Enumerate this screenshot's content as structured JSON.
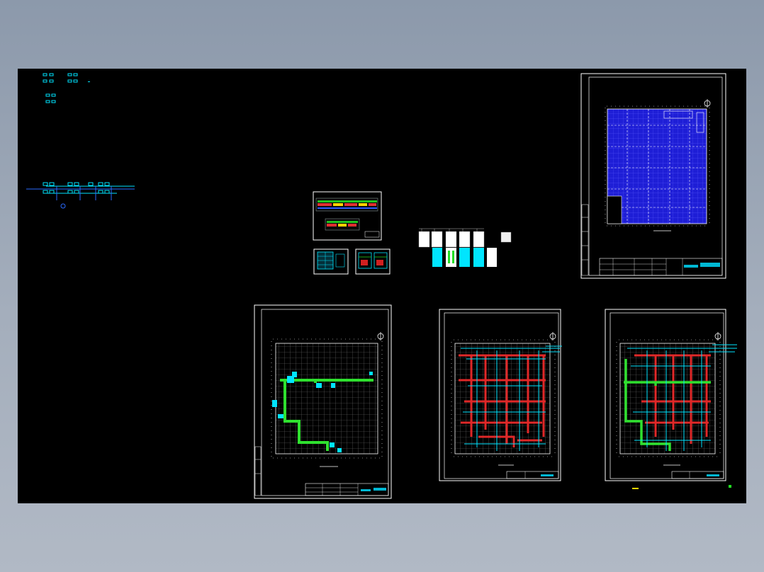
{
  "app": {
    "view": "model-space",
    "colors": {
      "background": "#000000",
      "frame": "#ffffff",
      "cyan": "#00e5ff",
      "green": "#22dd22",
      "red": "#e02020",
      "blue_fill": "#1a1ad0",
      "yellow": "#ffd800",
      "grid": "#7a7a7a"
    }
  },
  "drawing_sheets": [
    {
      "id": "sheet-top-right",
      "style": "blue-hatched-floor-plan",
      "has_north_arrow": true
    },
    {
      "id": "sheet-bottom-left",
      "style": "green-duct-plan",
      "has_north_arrow": true
    },
    {
      "id": "sheet-bottom-middle",
      "style": "red-cyan-piping-plan",
      "has_north_arrow": true
    },
    {
      "id": "sheet-bottom-right",
      "style": "green-red-combined-plan",
      "has_north_arrow": true
    }
  ],
  "small_details": [
    {
      "id": "elevation-sheet",
      "style": "colored-elevation"
    },
    {
      "id": "detail-sheet-a",
      "style": "cyan-detail"
    },
    {
      "id": "detail-sheet-b",
      "style": "section-detail"
    },
    {
      "id": "equipment-row",
      "count": 6
    }
  ],
  "markers": [
    {
      "id": "yellow-marker",
      "color": "#ffd800"
    },
    {
      "id": "green-marker",
      "color": "#22dd22"
    }
  ]
}
